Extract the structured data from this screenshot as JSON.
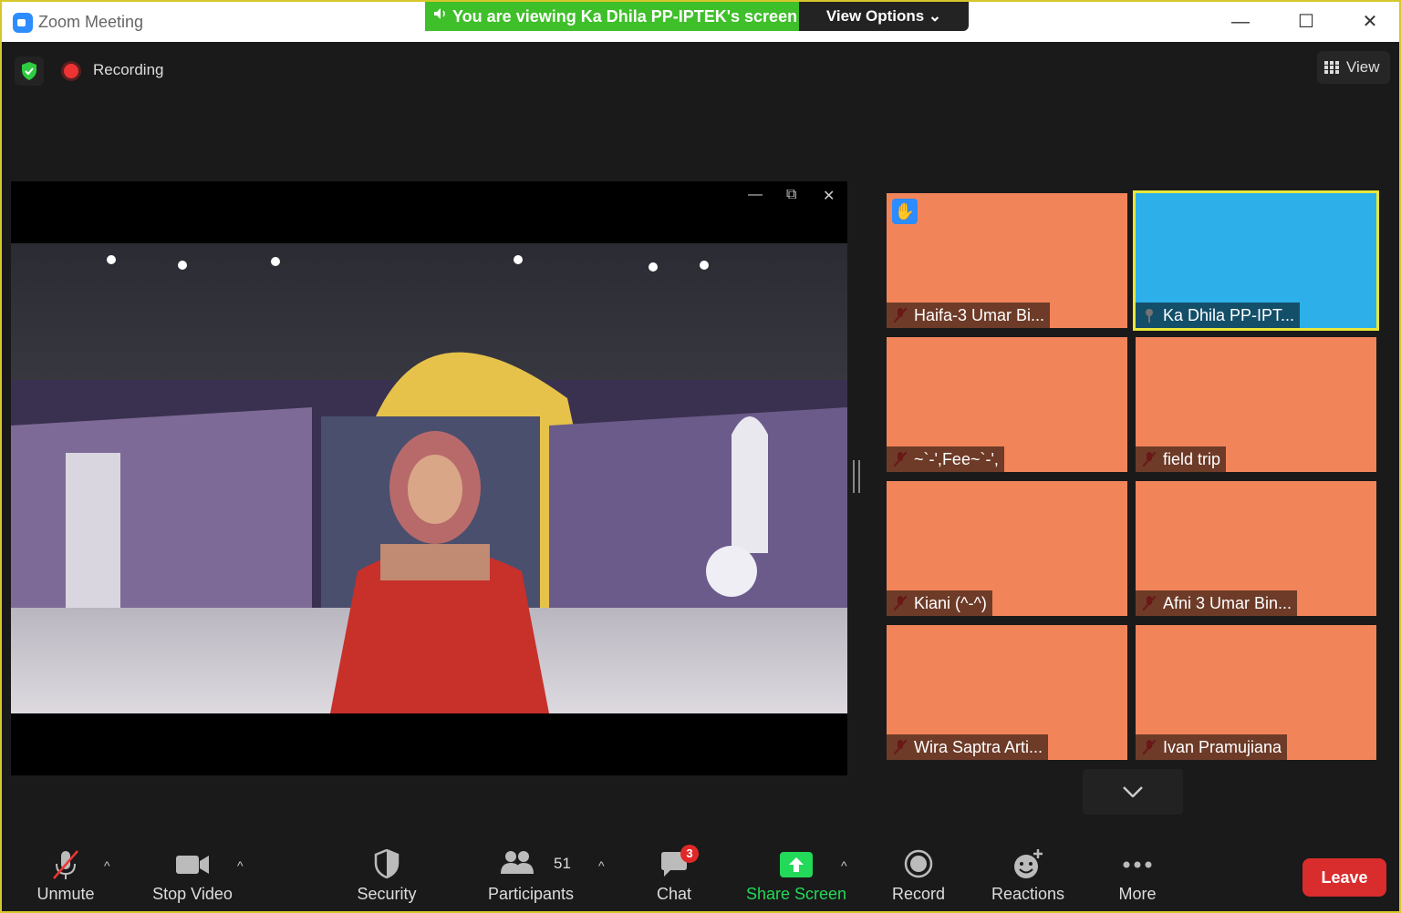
{
  "window": {
    "title": "Zoom Meeting",
    "minimize": "—",
    "maximize": "☐",
    "close": "✕"
  },
  "banner": {
    "viewing": "You are viewing Ka Dhila PP-IPTEK's screen",
    "view_options": "View Options ⌄"
  },
  "topbar": {
    "recording": "Recording",
    "view": "View"
  },
  "share": {
    "ctl_min": "—",
    "ctl_restore": "⧉",
    "ctl_close": "✕"
  },
  "gallery": [
    {
      "name": "Haifa-3 Umar Bi...",
      "raised_hand": true
    },
    {
      "name": "Ka Dhila PP-IPT...",
      "active": true
    },
    {
      "name": "~`-',Fee~`-',"
    },
    {
      "name": "field trip"
    },
    {
      "name": "Kiani (^-^)"
    },
    {
      "name": "Afni 3 Umar Bin..."
    },
    {
      "name": "Wira Saptra Arti..."
    },
    {
      "name": "Ivan Pramujiana"
    }
  ],
  "toolbar": {
    "unmute": "Unmute",
    "stop_video": "Stop Video",
    "security": "Security",
    "participants": "Participants",
    "participants_count": "51",
    "chat": "Chat",
    "chat_badge": "3",
    "share_screen": "Share Screen",
    "record": "Record",
    "reactions": "Reactions",
    "more": "More",
    "leave": "Leave"
  },
  "colors": {
    "accent_green": "#3fbf2a",
    "share_green": "#23d959",
    "leave_red": "#d92c2c",
    "frame_yellow": "#d6c82b",
    "tile_orange": "#f2845a"
  }
}
